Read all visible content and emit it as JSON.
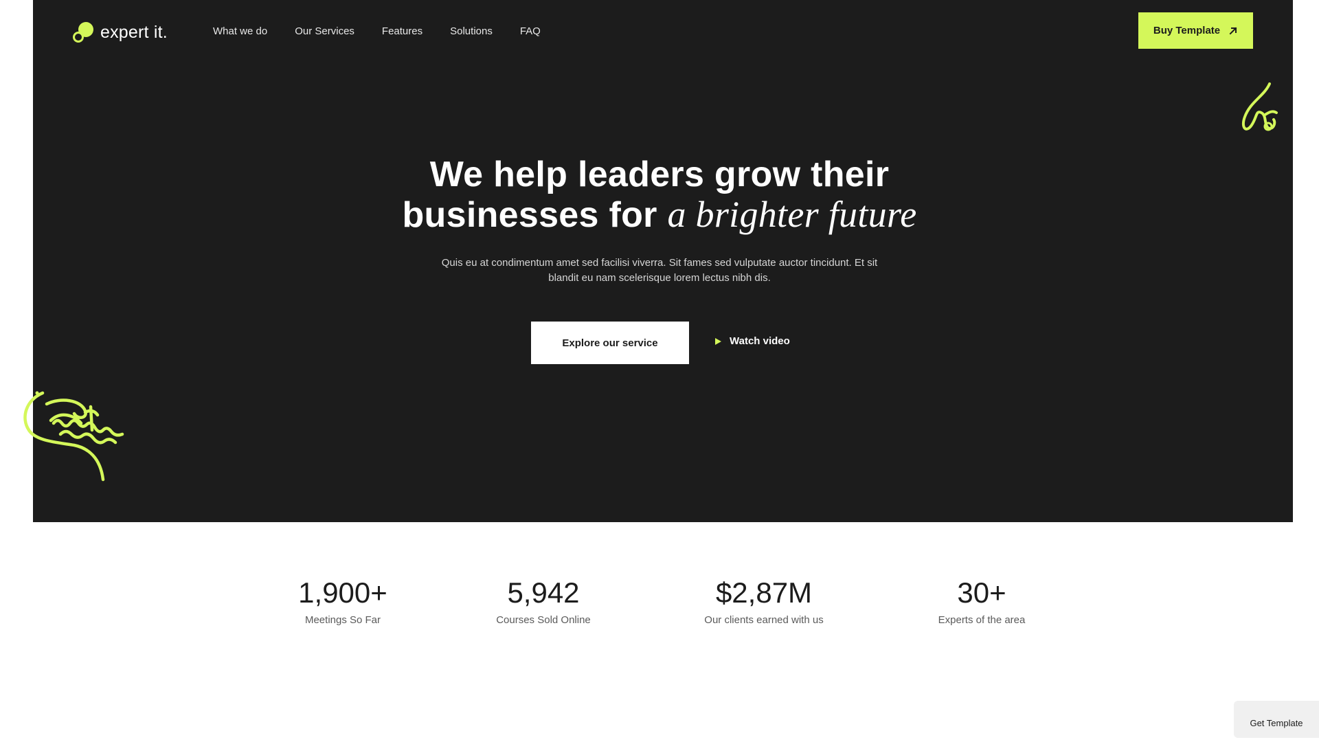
{
  "brand": {
    "name": "expert it."
  },
  "nav": {
    "items": [
      {
        "label": "What we do"
      },
      {
        "label": "Our Services"
      },
      {
        "label": "Features"
      },
      {
        "label": "Solutions"
      },
      {
        "label": "FAQ"
      }
    ],
    "cta_label": "Buy Template"
  },
  "hero": {
    "headline_line1": "We help leaders grow their",
    "headline_line2_plain": "businesses for ",
    "headline_line2_accent": "a brighter future",
    "subtitle": "Quis eu at condimentum amet sed facilisi viverra. Sit fames sed vulputate auctor tincidunt. Et sit blandit eu nam scelerisque lorem lectus nibh dis.",
    "primary_button": "Explore our service",
    "secondary_button": "Watch video"
  },
  "stats": [
    {
      "value": "1,900+",
      "label": "Meetings So Far"
    },
    {
      "value": "5,942",
      "label": "Courses Sold Online"
    },
    {
      "value": "$2,87M",
      "label": "Our clients earned with us"
    },
    {
      "value": "30+",
      "label": "Experts of the area"
    }
  ],
  "floating": {
    "get_template": "Get Template"
  },
  "colors": {
    "background": "#1c1c1c",
    "accent": "#d4f75a",
    "text_light": "#ffffff"
  },
  "icons": {
    "logo": "logo-circles-icon",
    "buy": "arrow-up-right-icon",
    "play": "play-icon"
  }
}
